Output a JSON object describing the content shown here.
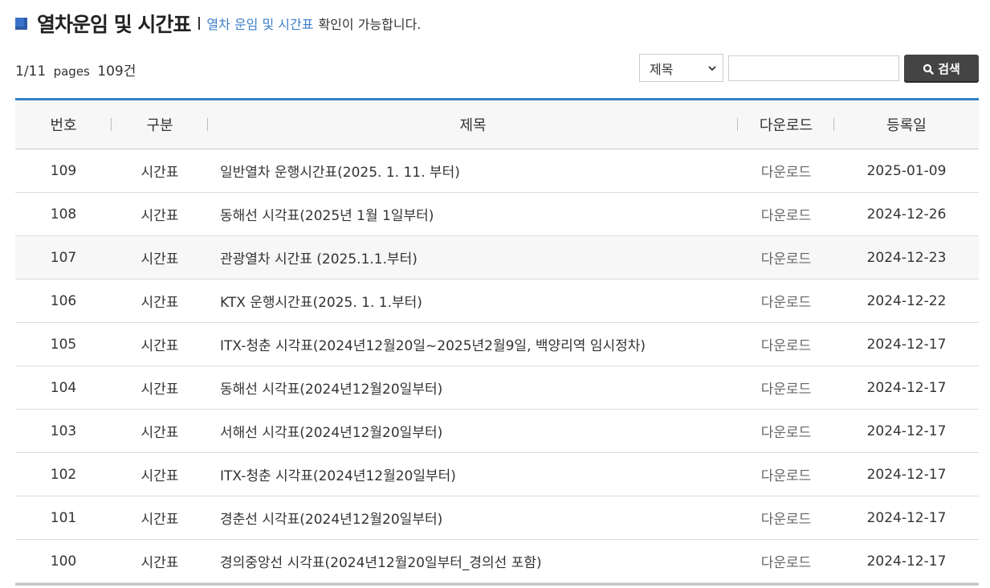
{
  "header": {
    "title": "열차운임 및 시간표",
    "highlight": "열차 운임 및 시간표",
    "description": "확인이 가능합니다."
  },
  "summary": {
    "pages": "1/11",
    "pages_word": "pages",
    "total": "109건"
  },
  "search": {
    "select_value": "제목",
    "input_value": "",
    "button_label": "검색"
  },
  "table": {
    "headers": {
      "no": "번호",
      "category": "구분",
      "title": "제목",
      "download": "다운로드",
      "date": "등록일"
    },
    "rows": [
      {
        "no": "109",
        "category": "시간표",
        "title": "일반열차 운행시간표(2025. 1. 11. 부터)",
        "download": "다운로드",
        "date": "2025-01-09"
      },
      {
        "no": "108",
        "category": "시간표",
        "title": "동해선 시각표(2025년 1월 1일부터)",
        "download": "다운로드",
        "date": "2024-12-26"
      },
      {
        "no": "107",
        "category": "시간표",
        "title": "관광열차 시간표 (2025.1.1.부터)",
        "download": "다운로드",
        "date": "2024-12-23"
      },
      {
        "no": "106",
        "category": "시간표",
        "title": "KTX 운행시간표(2025. 1. 1.부터)",
        "download": "다운로드",
        "date": "2024-12-22"
      },
      {
        "no": "105",
        "category": "시간표",
        "title": "ITX-청춘 시각표(2024년12월20일~2025년2월9일, 백양리역 임시정차)",
        "download": "다운로드",
        "date": "2024-12-17"
      },
      {
        "no": "104",
        "category": "시간표",
        "title": "동해선 시각표(2024년12월20일부터)",
        "download": "다운로드",
        "date": "2024-12-17"
      },
      {
        "no": "103",
        "category": "시간표",
        "title": "서해선 시각표(2024년12월20일부터)",
        "download": "다운로드",
        "date": "2024-12-17"
      },
      {
        "no": "102",
        "category": "시간표",
        "title": "ITX-청춘 시각표(2024년12월20일부터)",
        "download": "다운로드",
        "date": "2024-12-17"
      },
      {
        "no": "101",
        "category": "시간표",
        "title": "경춘선 시각표(2024년12월20일부터)",
        "download": "다운로드",
        "date": "2024-12-17"
      },
      {
        "no": "100",
        "category": "시간표",
        "title": "경의중앙선 시각표(2024년12월20일부터_경의선 포함)",
        "download": "다운로드",
        "date": "2024-12-17"
      }
    ]
  },
  "colors": {
    "accent": "#3480c6",
    "highlight_text": "#3d7fc9",
    "button_bg": "#444444",
    "row_shade": "#f7f7f7"
  },
  "icons": {
    "title_marker": "square-bullet-icon",
    "select_arrow": "chevron-down-icon",
    "search": "search-icon"
  }
}
